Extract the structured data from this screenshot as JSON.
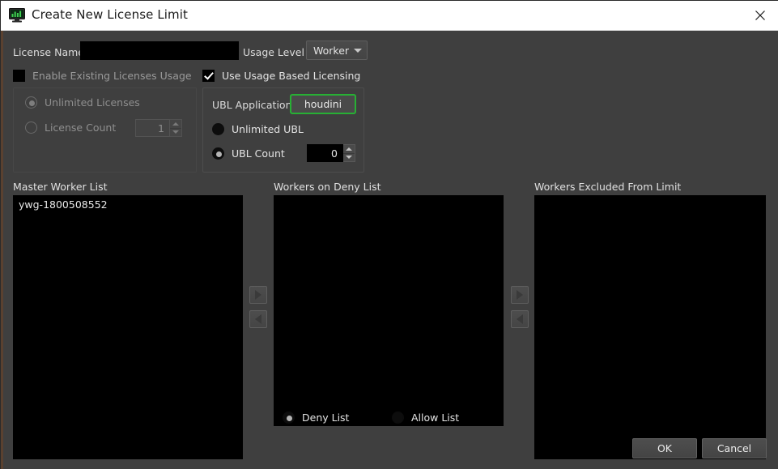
{
  "window": {
    "title": "Create New License Limit",
    "icon": "monitor-chart-icon",
    "close_label": "✕"
  },
  "form": {
    "license_name_label": "License Name",
    "license_name_value": "",
    "license_name_placeholder": "",
    "usage_level_label": "Usage Level",
    "usage_level_value": "Worker",
    "usage_level_options": [
      "Worker"
    ],
    "enable_existing_label": "Enable Existing Licenses Usage",
    "enable_existing_checked": false,
    "use_ubl_label": "Use Usage Based Licensing",
    "use_ubl_checked": true
  },
  "existing_group": {
    "enabled": false,
    "unlimited_label": "Unlimited Licenses",
    "unlimited_selected": true,
    "count_label": "License Count",
    "count_selected": false,
    "count_value": "1"
  },
  "ubl_group": {
    "enabled": true,
    "app_label": "UBL Application",
    "app_value": "houdini",
    "app_border_color": "#27b034",
    "unlimited_label": "Unlimited UBL",
    "unlimited_selected": false,
    "count_label": "UBL Count",
    "count_selected": true,
    "count_value": "0"
  },
  "lists": {
    "master": {
      "header": "Master Worker List",
      "items": [
        "ywg-1800508552"
      ]
    },
    "deny": {
      "header": "Workers on Deny List",
      "items": []
    },
    "excluded": {
      "header": "Workers Excluded From Limit",
      "items": []
    }
  },
  "transfer": {
    "add_icon": "arrow-right-icon",
    "remove_icon": "arrow-left-icon"
  },
  "list_mode": {
    "deny_label": "Deny List",
    "deny_selected": true,
    "allow_label": "Allow List",
    "allow_selected": false
  },
  "footer": {
    "ok_label": "OK",
    "cancel_label": "Cancel"
  }
}
